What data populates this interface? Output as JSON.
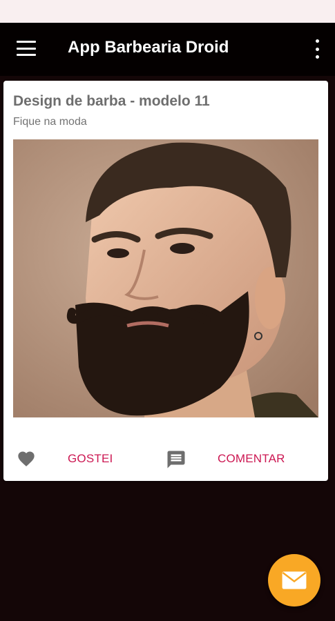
{
  "status_bar": {
    "left_text": "",
    "right_text": ""
  },
  "app_bar": {
    "title": "App Barbearia Droid",
    "menu_icon": "hamburger-menu-icon",
    "overflow_icon": "more-vert-icon"
  },
  "card": {
    "title": "Design de barba - modelo 11",
    "subtitle": "Fique na moda",
    "image_description": "bearded-man-portrait",
    "actions": {
      "like_icon": "heart-icon",
      "like_label": "GOSTEI",
      "comment_icon": "comment-icon",
      "comment_label": "COMENTAR"
    }
  },
  "fab": {
    "icon": "mail-icon"
  },
  "colors": {
    "background": "#140607",
    "app_bar": "#040000",
    "accent": "#cc1752",
    "fab": "#f9a825",
    "card": "#ffffff"
  }
}
